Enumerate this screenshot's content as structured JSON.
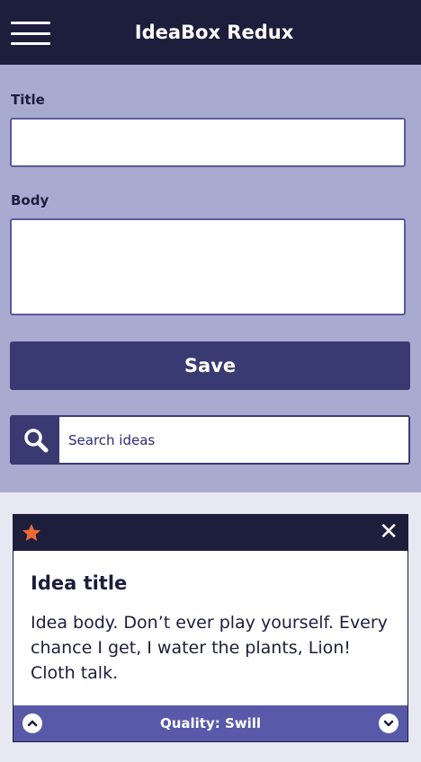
{
  "header": {
    "title": "IdeaBox Redux",
    "menu_icon": "hamburger-menu-icon"
  },
  "form": {
    "title_label": "Title",
    "title_value": "",
    "body_label": "Body",
    "body_value": "",
    "save_label": "Save",
    "search_placeholder": "Search ideas",
    "search_icon": "search-icon"
  },
  "ideas": [
    {
      "title": "Idea title",
      "body": "Idea body. Don’t ever play yourself. Every chance I get, I water the plants, Lion! Cloth talk.",
      "quality_label": "Quality: Swill",
      "starred": true,
      "star_color": "#ee6a35"
    }
  ],
  "colors": {
    "header_bg": "#1d1d3c",
    "form_bg": "#a8aad0",
    "accent": "#3a3a72",
    "card_footer": "#5859a8"
  }
}
